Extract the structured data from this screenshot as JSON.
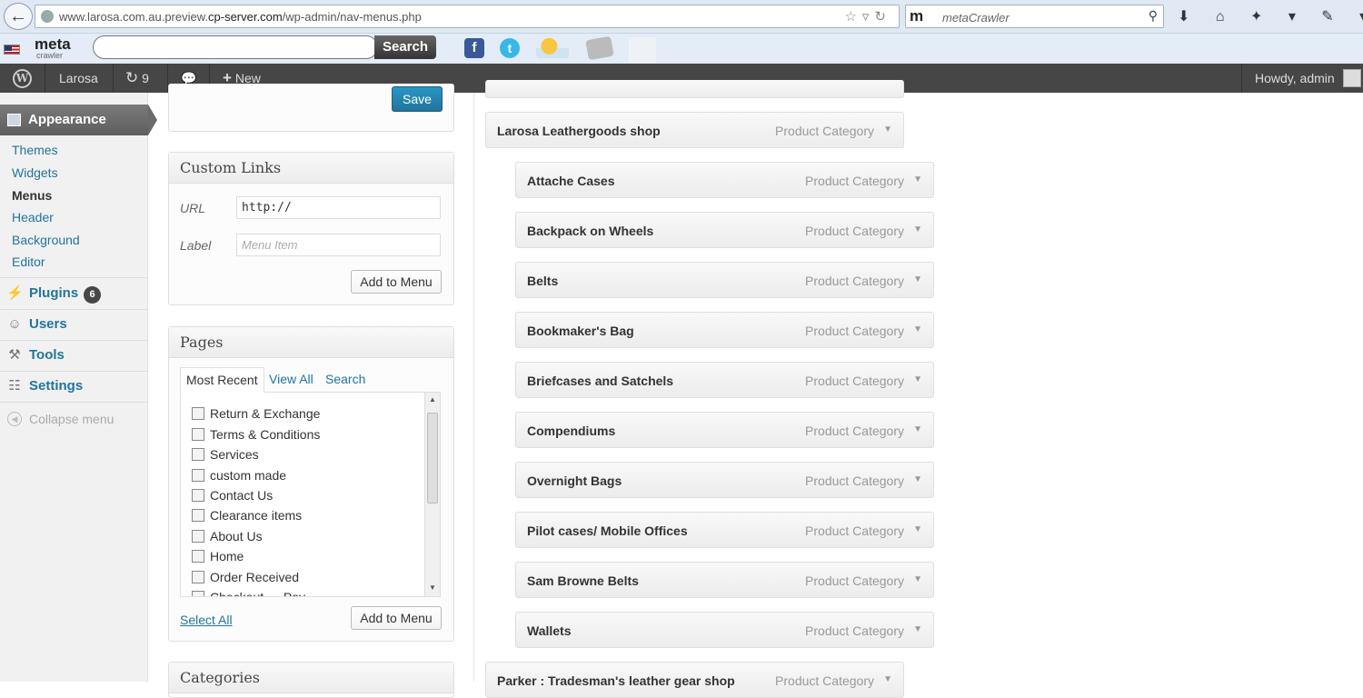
{
  "browser": {
    "url_prefix": "www.larosa.com.au.preview.",
    "url_domain": "cp-server.com",
    "url_path": "/wp-admin/nav-menus.php",
    "search_engine_logo": "m",
    "search_engine_name": "metaCrawler",
    "toolbar_logo": "meta",
    "toolbar_logo_sub": "crawler",
    "toolbar_search_label": "Search",
    "nav_icons": "⬇ ⌂ ✦ ▾ ✎ ▾"
  },
  "adminbar": {
    "site_name": "Larosa",
    "updates_count": "9",
    "new_label": "New",
    "howdy": "Howdy, admin"
  },
  "sidebar": {
    "appearance": "Appearance",
    "submenu": [
      "Themes",
      "Widgets",
      "Menus",
      "Header",
      "Background",
      "Editor"
    ],
    "plugins": "Plugins",
    "plugins_badge": "6",
    "users": "Users",
    "tools": "Tools",
    "settings": "Settings",
    "collapse": "Collapse menu"
  },
  "top_panel": {
    "save_label": "Save"
  },
  "custom_links": {
    "title": "Custom Links",
    "url_label": "URL",
    "url_value": "http://",
    "label_label": "Label",
    "label_placeholder": "Menu Item",
    "add_button": "Add to Menu"
  },
  "pages": {
    "title": "Pages",
    "tabs": [
      "Most Recent",
      "View All",
      "Search"
    ],
    "items": [
      "Return & Exchange",
      "Terms & Conditions",
      "Services",
      "custom made",
      "Contact Us",
      "Clearance items",
      "About Us",
      "Home",
      "Order Received",
      "Checkout → Pay"
    ],
    "select_all": "Select All",
    "add_button": "Add to Menu"
  },
  "categories": {
    "title": "Categories"
  },
  "menu_structure": {
    "parent": {
      "title": "Larosa Leathergoods shop",
      "type": "Product Category"
    },
    "children": [
      {
        "title": "Attache Cases",
        "type": "Product Category"
      },
      {
        "title": "Backpack on Wheels",
        "type": "Product Category"
      },
      {
        "title": "Belts",
        "type": "Product Category"
      },
      {
        "title": "Bookmaker's Bag",
        "type": "Product Category"
      },
      {
        "title": "Briefcases and Satchels",
        "type": "Product Category"
      },
      {
        "title": "Compendiums",
        "type": "Product Category"
      },
      {
        "title": "Overnight Bags",
        "type": "Product Category"
      },
      {
        "title": "Pilot cases/ Mobile Offices",
        "type": "Product Category"
      },
      {
        "title": "Sam Browne Belts",
        "type": "Product Category"
      },
      {
        "title": "Wallets",
        "type": "Product Category"
      }
    ],
    "next_parent": {
      "title": "Parker : Tradesman's leather gear shop",
      "type": "Product Category"
    }
  }
}
